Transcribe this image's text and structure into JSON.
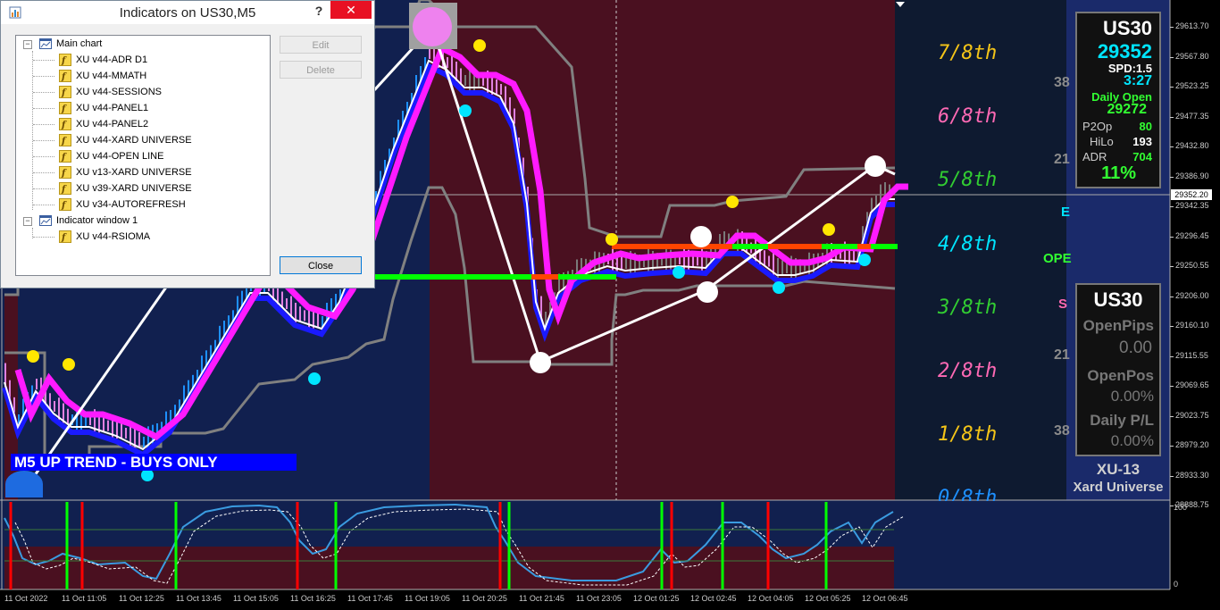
{
  "dialog": {
    "title": "Indicators on US30,M5",
    "help_label": "?",
    "close_x": "✕",
    "edit_label": "Edit",
    "delete_label": "Delete",
    "close_label": "Close",
    "tree": {
      "main_chart_label": "Main chart",
      "main_items": [
        "XU v44-ADR D1",
        "XU v44-MMATH",
        "XU v44-SESSIONS",
        "XU v44-PANEL1",
        "XU v44-PANEL2",
        "XU v44-XARD UNIVERSE",
        "XU v44-OPEN LINE",
        "XU v13-XARD UNIVERSE",
        "XU v39-XARD UNIVERSE",
        "XU v34-AUTOREFRESH"
      ],
      "window_label": "Indicator window 1",
      "window_items": [
        "XU v44-RSIOMA"
      ]
    }
  },
  "chart": {
    "trend_banner": "M5 UP TREND - BUYS ONLY",
    "current_price": "29352.20",
    "price_ticks": [
      "29613.70",
      "29567.80",
      "29523.25",
      "29477.35",
      "29432.80",
      "29386.90",
      "29342.35",
      "29296.45",
      "29250.55",
      "29206.00",
      "29160.10",
      "29115.55",
      "29069.65",
      "29023.75",
      "28979.20",
      "28933.30",
      "28888.75"
    ],
    "time_ticks": [
      "11 Oct 2022",
      "11 Oct 11:05",
      "11 Oct 12:25",
      "11 Oct 13:45",
      "11 Oct 15:05",
      "11 Oct 16:25",
      "11 Oct 17:45",
      "11 Oct 19:05",
      "11 Oct 20:25",
      "11 Oct 21:45",
      "11 Oct 23:05",
      "12 Oct 01:25",
      "12 Oct 02:45",
      "12 Oct 04:05",
      "12 Oct 05:25",
      "12 Oct 06:45"
    ],
    "octaves": [
      {
        "label": "7/8th",
        "color": "#f5c518"
      },
      {
        "label": "6/8th",
        "color": "#ff69b4"
      },
      {
        "label": "5/8th",
        "color": "#32cd32"
      },
      {
        "label": "4/8th",
        "color": "#00e5ff"
      },
      {
        "label": "3/8th",
        "color": "#32cd32"
      },
      {
        "label": "2/8th",
        "color": "#ff69b4"
      },
      {
        "label": "1/8th",
        "color": "#f5c518"
      },
      {
        "label": "0/8th",
        "color": "#1e90ff"
      }
    ],
    "side_numbers": [
      "38",
      "21",
      "21",
      "38"
    ],
    "side_labels": [
      "E",
      "OPE",
      "S"
    ],
    "sub_window_ticks": [
      "100",
      "0"
    ]
  },
  "panel1": {
    "symbol": "US30",
    "price": "29352",
    "spread": "SPD:1.5",
    "timer": "3:27",
    "daily_open_label": "Daily Open",
    "daily_open": "29272",
    "p2op_label": "P2Op",
    "p2op": "80",
    "hilo_label": "HiLo",
    "hilo": "193",
    "adr_label": "ADR",
    "adr": "704",
    "adr_pct": "11%"
  },
  "panel2": {
    "symbol": "US30",
    "open_pips_label": "OpenPips",
    "open_pips": "0.00",
    "open_pos_label": "OpenPos",
    "open_pos": "0.00%",
    "daily_pl_label": "Daily P/L",
    "daily_pl": "0.00%"
  },
  "branding": {
    "name": "XU-13",
    "subtitle": "Xard Universe"
  },
  "colors": {
    "blue_zone": "#11204f",
    "red_zone": "#4a1020",
    "dark_zone": "#0e1a30",
    "price_axis_bg": "#000000",
    "ma_blue": "#1a1aff",
    "ma_magenta": "#ff1aff",
    "cyan": "#00e5ff",
    "yellow": "#ffe600"
  }
}
